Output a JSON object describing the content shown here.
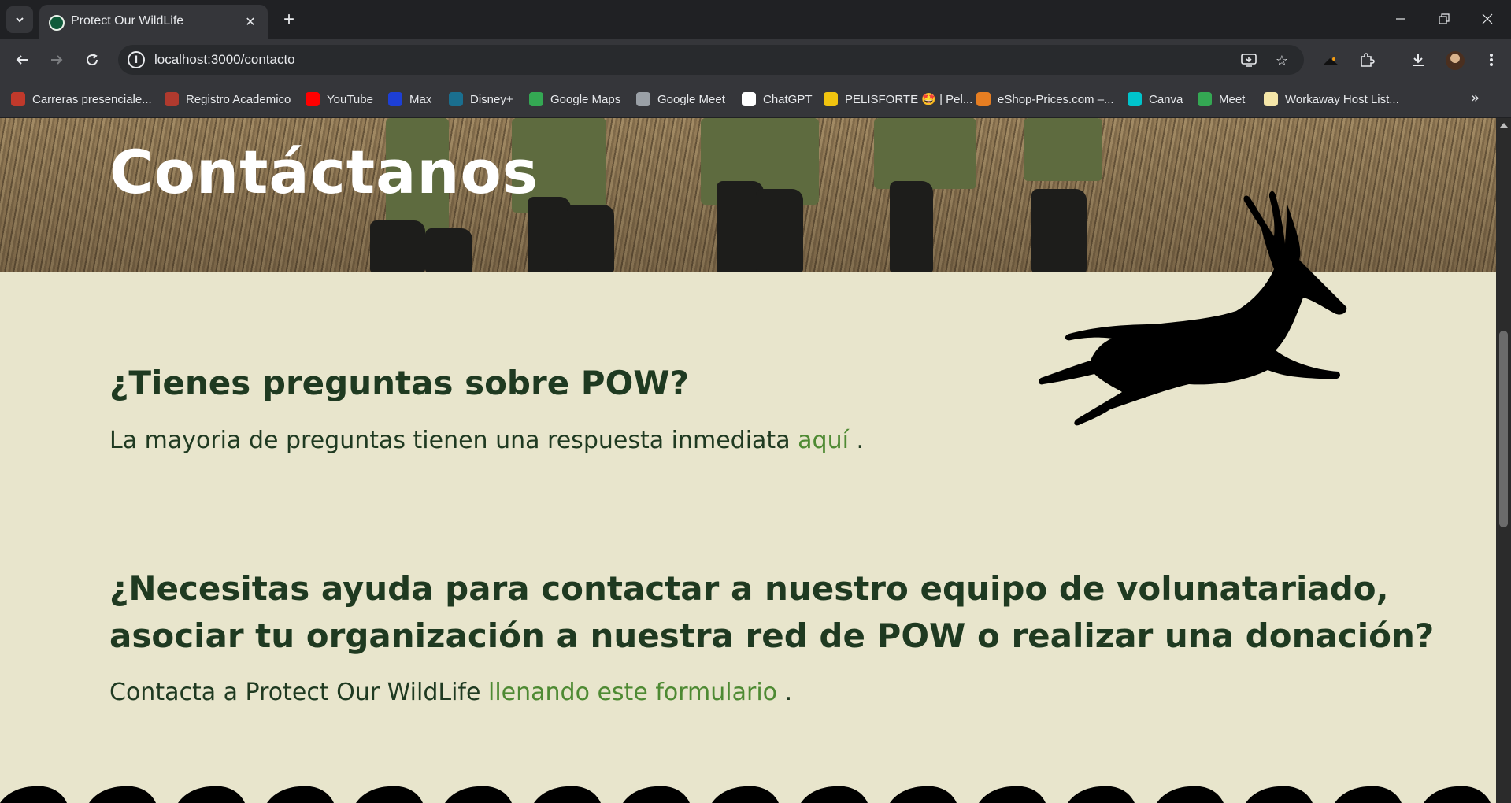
{
  "browser": {
    "tab_title": "Protect Our WildLife",
    "url": "localhost:3000/contacto",
    "bookmarks": [
      {
        "label": "Carreras presenciale...",
        "color": "#c0392b"
      },
      {
        "label": "Registro Academico",
        "color": "#b03a2e"
      },
      {
        "label": "YouTube",
        "color": "#ff0000"
      },
      {
        "label": "Max",
        "color": "#1d3fd6"
      },
      {
        "label": "Disney+",
        "color": "#1a6f8f"
      },
      {
        "label": "Google Maps",
        "color": "#34a853"
      },
      {
        "label": "Google Meet",
        "color": "#9aa0a6"
      },
      {
        "label": "ChatGPT",
        "color": "#ffffff"
      },
      {
        "label": "PELISFORTE 🤩 | Pel...",
        "color": "#f1c40f"
      },
      {
        "label": "eShop-Prices.com –...",
        "color": "#e67e22"
      },
      {
        "label": "Canva",
        "color": "#00c4cc"
      },
      {
        "label": "Meet",
        "color": "#34a853"
      },
      {
        "label": "Workaway Host List...",
        "color": "#f5e6a8"
      }
    ]
  },
  "page": {
    "hero_title": "Contáctanos",
    "q1_heading": "¿Tienes preguntas sobre POW?",
    "q1_text": "La mayoria de preguntas tienen una respuesta inmediata",
    "q1_link": "aquí",
    "q1_end": " .",
    "q2_heading": "¿Necesitas ayuda para contactar a nuestro equipo de volunatariado, asociar tu organización a nuestra red de POW o realizar una donación?",
    "q2_text": "Contacta a Protect Our WildLife",
    "q2_link": "llenando este formulario",
    "q2_end": " ."
  },
  "colors": {
    "page_bg": "#e8e5cc",
    "heading": "#1f3a21",
    "link": "#4e8a33"
  }
}
